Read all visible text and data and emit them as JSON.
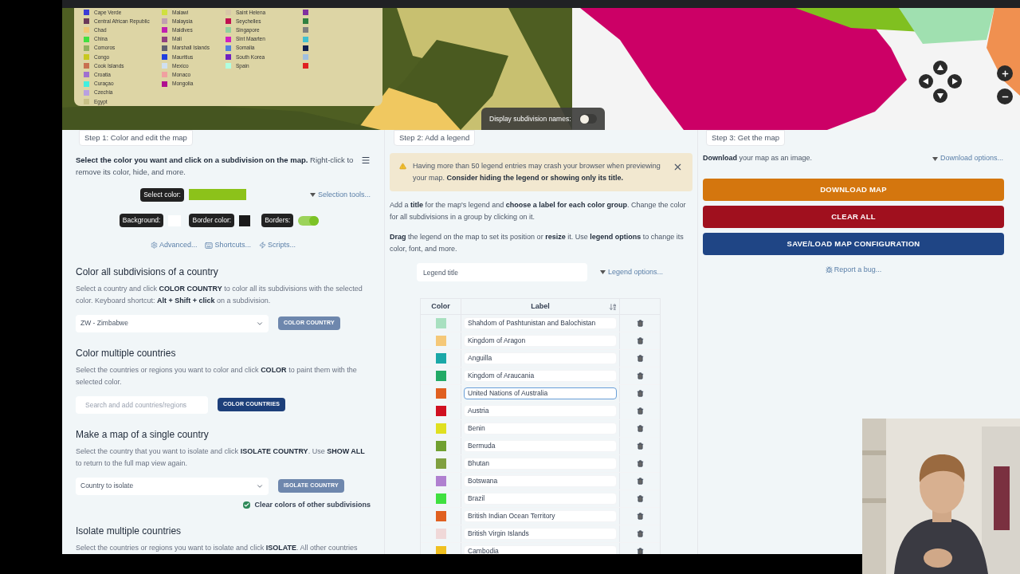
{
  "map": {
    "legend": {
      "columns": [
        [
          {
            "label": "Cape Verde",
            "color": "#3b3bd6"
          },
          {
            "label": "Central African Republic",
            "color": "#6b3a5a"
          },
          {
            "label": "Chad",
            "color": "#f0c878"
          },
          {
            "label": "China",
            "color": "#40e040"
          },
          {
            "label": "Comoros",
            "color": "#90b060"
          },
          {
            "label": "Congo",
            "color": "#c8c820"
          },
          {
            "label": "Cook Islands",
            "color": "#c87050"
          },
          {
            "label": "Croatia",
            "color": "#a070d0"
          },
          {
            "label": "Curaçao",
            "color": "#40f0e0"
          },
          {
            "label": "Czechia",
            "color": "#b8a0e0"
          },
          {
            "label": "Egypt",
            "color": "#c8c088"
          }
        ],
        [
          {
            "label": "Malawi",
            "color": "#d0e040"
          },
          {
            "label": "Malaysia",
            "color": "#c0a0b0"
          },
          {
            "label": "Maldives",
            "color": "#c020b0"
          },
          {
            "label": "Mali",
            "color": "#904080"
          },
          {
            "label": "Marshall Islands",
            "color": "#606070"
          },
          {
            "label": "Mauritius",
            "color": "#2040e0"
          },
          {
            "label": "Mexico",
            "color": "#d0e0f0"
          },
          {
            "label": "Monaco",
            "color": "#f0a0a0"
          },
          {
            "label": "Mongolia",
            "color": "#b01090"
          }
        ],
        [
          {
            "label": "Saint Helena",
            "color": "#d8c8a8"
          },
          {
            "label": "Seychelles",
            "color": "#c01050"
          },
          {
            "label": "Singapore",
            "color": "#90d0a0"
          },
          {
            "label": "Sint Maarten",
            "color": "#d020c0"
          },
          {
            "label": "Somalia",
            "color": "#5080e0"
          },
          {
            "label": "South Korea",
            "color": "#7020c0"
          },
          {
            "label": "Spain",
            "color": "#b0ffe0"
          }
        ],
        [
          {
            "color": "#8030a0"
          },
          {
            "color": "#308040"
          },
          {
            "color": "#808080"
          },
          {
            "color": "#40c0d0"
          },
          {
            "color": "#102050"
          },
          {
            "color": "#a0c0e0"
          },
          {
            "color": "#e02020"
          }
        ]
      ]
    },
    "subdivision_names": {
      "label": "Display subdivision names:",
      "on": false
    }
  },
  "step1": {
    "tab": "Step 1: Color and edit the map",
    "intro": "**Select the color you want and click on a subdivision on the map.** Right-click to remove its color, hide, and more.",
    "select_color": {
      "label": "Select color:",
      "color": "#8cc21a"
    },
    "selection_tools": "Selection tools...",
    "background": {
      "label": "Background:",
      "color": "#ffffff"
    },
    "border_color": {
      "label": "Border color:",
      "color": "#1a1a1a"
    },
    "borders": {
      "label": "Borders:",
      "on": true
    },
    "links": [
      "Advanced...",
      "Shortcuts...",
      "Scripts..."
    ],
    "sections": [
      {
        "kind": "select",
        "title": "Color all subdivisions of a country",
        "text": "Select a country and click **COLOR COUNTRY** to color all its subdivisions with the selected color. Keyboard shortcut: **Alt + Shift + click** on a subdivision.",
        "value": "ZW - Zimbabwe",
        "button": {
          "label": "COLOR COUNTRY",
          "disabled": true
        }
      },
      {
        "kind": "search",
        "title": "Color multiple countries",
        "text": "Select the countries or regions you want to color and click **COLOR** to paint them with the selected color.",
        "placeholder": "Search and add countries/regions",
        "button": {
          "label": "COLOR COUNTRIES",
          "disabled": false
        }
      },
      {
        "kind": "select",
        "title": "Make a map of a single country",
        "text": "Select the country that you want to isolate and click **ISOLATE COUNTRY**. Use **SHOW ALL** to return to the full map view again.",
        "placeholder": "Country to isolate",
        "button": {
          "label": "ISOLATE COUNTRY",
          "disabled": true
        },
        "checkbox": {
          "label": "Clear colors of other subdivisions",
          "checked": true
        }
      },
      {
        "kind": "text",
        "title": "Isolate multiple countries",
        "text": "Select the countries or regions you want to isolate and click **ISOLATE**. All other countries"
      }
    ]
  },
  "step2": {
    "tab": "Step 2: Add a legend",
    "alert": "Having more than 50 legend entries may crash your browser when previewing your map. **Consider hiding the legend or showing only its title.**",
    "paragraphs": [
      "Add a **title** for the map's legend and **choose a label for each color group**. Change the color for all subdivisions in a group by clicking on it.",
      "**Drag** the legend on the map to set its position or **resize** it. Use **legend options** to change its color, font, and more."
    ],
    "legend_title": {
      "placeholder": "Legend title"
    },
    "legend_options": "Legend options...",
    "table": {
      "columns": [
        "Color",
        "Label"
      ],
      "rows": [
        {
          "color": "#a8e0c0",
          "label": "Shahdom of Pashtunistan and Balochistan",
          "focused": false
        },
        {
          "color": "#f5c878",
          "label": "Kingdom of Aragon",
          "focused": false
        },
        {
          "color": "#1aa8a8",
          "label": "Anguilla",
          "focused": false
        },
        {
          "color": "#22aa66",
          "label": "Kingdom of Araucania",
          "focused": false
        },
        {
          "color": "#e06020",
          "label": "United Nations of Australia",
          "focused": true
        },
        {
          "color": "#d01020",
          "label": "Austria",
          "focused": false
        },
        {
          "color": "#e0e020",
          "label": "Benin",
          "focused": false
        },
        {
          "color": "#70a030",
          "label": "Bermuda",
          "focused": false
        },
        {
          "color": "#80a040",
          "label": "Bhutan",
          "focused": false
        },
        {
          "color": "#b080d0",
          "label": "Botswana",
          "focused": false
        },
        {
          "color": "#40e040",
          "label": "Brazil",
          "focused": false
        },
        {
          "color": "#e06020",
          "label": "British Indian Ocean Territory",
          "focused": false
        },
        {
          "color": "#f0d8d8",
          "label": "British Virgin Islands",
          "focused": false
        },
        {
          "color": "#f0c020",
          "label": "Cambodia",
          "focused": false
        }
      ]
    }
  },
  "step3": {
    "tab": "Step 3: Get the map",
    "text": "**Download** your map as an image.",
    "download_options": "Download options...",
    "buttons": [
      {
        "label": "DOWNLOAD MAP",
        "color": "#d4760e"
      },
      {
        "label": "CLEAR ALL",
        "color": "#a0101e"
      },
      {
        "label": "SAVE/LOAD MAP CONFIGURATION",
        "color": "#1f4585"
      }
    ],
    "report": "Report a bug..."
  }
}
